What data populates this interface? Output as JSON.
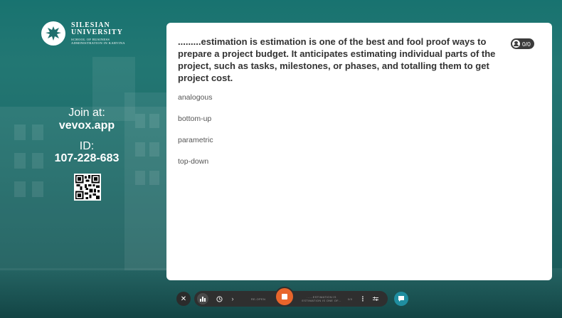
{
  "branding": {
    "line1": "SILESIAN",
    "line2": "UNIVERSITY",
    "line3": "SCHOOL OF BUSINESS",
    "line4": "ADMINISTRATION IN KARVINA"
  },
  "join": {
    "label": "Join at:",
    "url": "vevox.app",
    "id_label": "ID:",
    "id_value": "107-228-683"
  },
  "question": {
    "text": ".........estimation is estimation is one of the best and fool proof ways to prepare a project budget. It anticipates estimating individual parts of the project, such as tasks, milestones, or phases, and totalling them to get project cost.",
    "badge": "0/0"
  },
  "options": [
    {
      "label": "analogous"
    },
    {
      "label": "bottom-up"
    },
    {
      "label": "parametric"
    },
    {
      "label": "top-down"
    }
  ],
  "toolbar": {
    "close": "✕",
    "reopen_label": "RE-OPEN",
    "current_title": "......ESTIMATION IS ESTIMATION IS ONE OF...",
    "current_count": "0/0"
  },
  "colors": {
    "accent": "#e8652b",
    "teal": "#1f8ea0",
    "background": "#1f6f6d"
  }
}
